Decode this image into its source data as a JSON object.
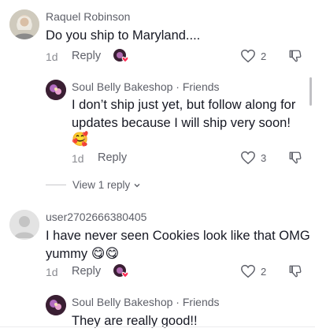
{
  "comments": [
    {
      "username": "Raquel Robinson",
      "text": "Do you ship to Maryland....",
      "time": "1d",
      "reply_label": "Reply",
      "like_count": "2"
    },
    {
      "username": "Soul Belly Bakeshop · Friends",
      "text_line1": "I don’t ship just yet, but follow along for",
      "text_line2": "updates because I will ship very soon!",
      "emoji": "🥰",
      "time": "1d",
      "reply_label": "Reply",
      "like_count": "3"
    },
    {
      "view_replies": "View 1 reply"
    },
    {
      "username": "user2702666380405",
      "text_line1": "I have never seen Cookies look like that OMG",
      "text_line2": "yummy",
      "emoji": "😋😋",
      "time": "1d",
      "reply_label": "Reply",
      "like_count": "2"
    },
    {
      "username": "Soul Belly Bakeshop · Friends",
      "text": "They are really good!!"
    }
  ],
  "icons": {
    "like": "heart-outline-icon",
    "dislike": "thumbs-down-outline-icon",
    "creator_liked": "creator-liked-heart-icon",
    "chevron": "chevron-down-icon"
  },
  "colors": {
    "accent_heart": "#fe2c55",
    "text_primary": "#161823",
    "text_secondary": "#5e6069"
  }
}
